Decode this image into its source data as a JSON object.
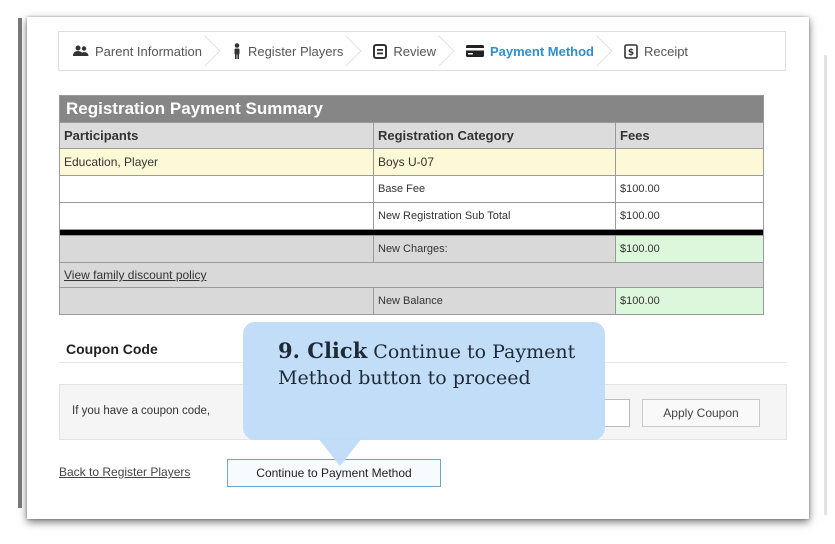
{
  "steps": [
    {
      "label": "Parent Information",
      "icon": "parents-icon"
    },
    {
      "label": "Register Players",
      "icon": "person-icon"
    },
    {
      "label": "Review",
      "icon": "review-icon"
    },
    {
      "label": "Payment Method",
      "icon": "credit-card-icon"
    },
    {
      "label": "Receipt",
      "icon": "receipt-icon"
    }
  ],
  "summary": {
    "title": "Registration Payment Summary",
    "headers": [
      "Participants",
      "Registration Category",
      "Fees"
    ],
    "participant": "Education, Player",
    "category": "Boys U-07",
    "base_fee_label": "Base Fee",
    "base_fee": "$100.00",
    "subtotal_label": "New Registration Sub Total",
    "subtotal": "$100.00",
    "charges_label": "New Charges:",
    "charges": "$100.00",
    "discount_link": "View family discount policy",
    "balance_label": "New Balance",
    "balance": "$100.00"
  },
  "coupon": {
    "heading": "Coupon Code",
    "prompt": "If you have a coupon code,",
    "apply_label": "Apply Coupon"
  },
  "nav": {
    "back_label": "Back to Register Players",
    "continue_label": "Continue to Payment Method"
  },
  "callout": {
    "step": "9. Click",
    "text": "Continue to Payment Method button to proceed"
  },
  "colors": {
    "active_step": "#2f8fd0",
    "title_bar": "#868686",
    "highlight_row": "#fdf8d6",
    "amount_green": "#ddf7dd",
    "callout_bg": "#bedcf7"
  }
}
